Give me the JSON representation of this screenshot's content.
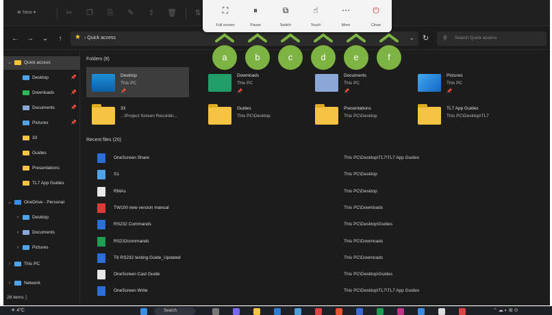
{
  "toolbar": {
    "new_label": "New"
  },
  "nav": {
    "back": "←",
    "forward": "→",
    "recent": "⌄",
    "up": "↑"
  },
  "address": {
    "crumb": "Quick access",
    "search_placeholder": "Search Quick access"
  },
  "sidebar": {
    "items": [
      {
        "label": "Quick access",
        "pinned": false
      },
      {
        "label": "Desktop",
        "pinned": true
      },
      {
        "label": "Downloads",
        "pinned": true
      },
      {
        "label": "Documents",
        "pinned": true
      },
      {
        "label": "Pictures",
        "pinned": true
      },
      {
        "label": "33",
        "pinned": false
      },
      {
        "label": "Guides",
        "pinned": false
      },
      {
        "label": "Presentations",
        "pinned": false
      },
      {
        "label": "TL7 App Guides",
        "pinned": false
      },
      {
        "label": "OneDrive - Personal",
        "pinned": false
      },
      {
        "label": "Desktop",
        "pinned": false
      },
      {
        "label": "Documents",
        "pinned": false
      },
      {
        "label": "Pictures",
        "pinned": false
      },
      {
        "label": "This PC",
        "pinned": false
      },
      {
        "label": "Network",
        "pinned": false
      }
    ],
    "status": "28 items"
  },
  "folders": {
    "heading": "Folders (8)",
    "items": [
      {
        "name": "Desktop",
        "path": "This PC",
        "icon": "desktop-folder",
        "pinned": true
      },
      {
        "name": "Downloads",
        "path": "This PC",
        "icon": "downloads-folder",
        "pinned": true
      },
      {
        "name": "Documents",
        "path": "This PC",
        "icon": "documents-folder",
        "pinned": true
      },
      {
        "name": "Pictures",
        "path": "This PC",
        "icon": "pictures-folder",
        "pinned": true
      },
      {
        "name": "33",
        "path": "...\\Project Screen Recordin...",
        "icon": "folder",
        "pinned": false
      },
      {
        "name": "Guides",
        "path": "This PC\\Desktop",
        "icon": "folder",
        "pinned": false
      },
      {
        "name": "Presentations",
        "path": "This PC\\Desktop",
        "icon": "folder",
        "pinned": false
      },
      {
        "name": "TL7 App Guides",
        "path": "This PC\\Desktop\\TL7",
        "icon": "folder",
        "pinned": false
      }
    ]
  },
  "recent": {
    "heading": "Recent files (20)",
    "items": [
      {
        "name": "OneScreen Share",
        "location": "This PC\\Desktop\\TL7\\TL7 App Guides",
        "icon": "word-doc"
      },
      {
        "name": "S1",
        "location": "This PC\\Desktop",
        "icon": "image-file"
      },
      {
        "name": "RMAs",
        "location": "This PC\\Desktop",
        "icon": "blank-file"
      },
      {
        "name": "TW100 new version manual",
        "location": "This PC\\Downloads",
        "icon": "pdf-file"
      },
      {
        "name": "RS232 Commands",
        "location": "This PC\\Desktop\\Guides",
        "icon": "word-doc"
      },
      {
        "name": "RS232commands",
        "location": "This PC\\Downloads",
        "icon": "excel-file"
      },
      {
        "name": "T6 RS232 testing Guide_Updated",
        "location": "This PC\\Downloads",
        "icon": "word-doc"
      },
      {
        "name": "OneScreen Cast Guide",
        "location": "This PC\\Desktop\\Guides",
        "icon": "blank-file"
      },
      {
        "name": "OneScreen Write",
        "location": "This PC\\Desktop\\TL7\\TL7 App Guides",
        "icon": "word-doc"
      }
    ]
  },
  "popup": {
    "buttons": [
      {
        "label": "Full screen",
        "icon": "fullscreen-icon",
        "callout": "a"
      },
      {
        "label": "Pause",
        "icon": "pause-icon",
        "callout": "b"
      },
      {
        "label": "Switch",
        "icon": "switch-icon",
        "callout": "c"
      },
      {
        "label": "Touch",
        "icon": "touch-icon",
        "callout": "d"
      },
      {
        "label": "More",
        "icon": "more-icon",
        "callout": "e"
      },
      {
        "label": "Close",
        "icon": "close-icon",
        "callout": "f"
      }
    ]
  },
  "taskbar": {
    "weather": "4°C",
    "search": "Search"
  },
  "colors": {
    "callout": "#7cb342",
    "accent": "#f4c430",
    "close": "#d83b3b"
  }
}
